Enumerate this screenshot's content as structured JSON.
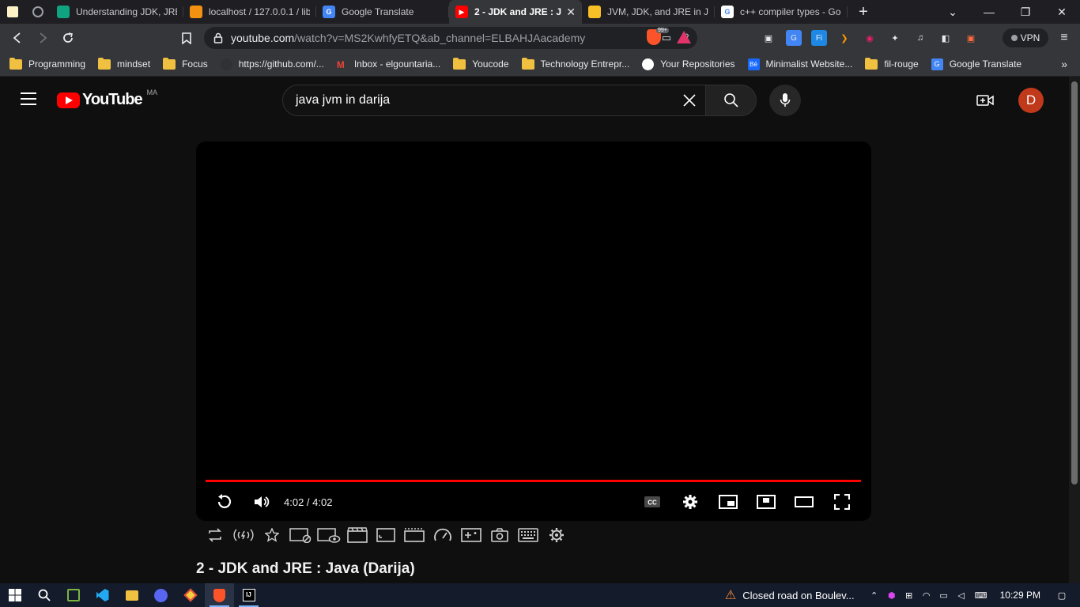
{
  "browser": {
    "tabs": [
      {
        "title": "Understanding JDK, JRE, J",
        "favicon_color": "#10a37f",
        "active": false
      },
      {
        "title": "localhost / 127.0.0.1 / libr",
        "favicon_color": "#f29111",
        "active": false
      },
      {
        "title": "Google Translate",
        "favicon_color": "#4285f4",
        "active": false
      },
      {
        "title": "2 - JDK and JRE : Java",
        "favicon_color": "#ff0000",
        "active": true
      },
      {
        "title": "JVM, JDK, and JRE in Java",
        "favicon_color": "#f6c026",
        "active": false
      },
      {
        "title": "c++ compiler types - Goo",
        "favicon_color": "#ffffff",
        "active": false
      }
    ],
    "address": {
      "domain": "youtube.com",
      "path": "/watch?v=MS2KwhfyETQ&ab_channel=ELBAHJAacademy"
    },
    "brave_badge": "99+",
    "vpn_label": "VPN",
    "bookmarks": [
      {
        "label": "Programming",
        "type": "folder"
      },
      {
        "label": "mindset",
        "type": "folder"
      },
      {
        "label": "Focus",
        "type": "folder"
      },
      {
        "label": "https://github.com/...",
        "type": "site",
        "icon": "github-icon"
      },
      {
        "label": "Inbox - elgountaria...",
        "type": "site",
        "icon": "gmail-icon"
      },
      {
        "label": "Youcode",
        "type": "folder"
      },
      {
        "label": "Technology Entrepr...",
        "type": "folder"
      },
      {
        "label": "Your Repositories",
        "type": "site",
        "icon": "github-icon"
      },
      {
        "label": "Minimalist Website...",
        "type": "site",
        "icon": "behance-icon"
      },
      {
        "label": "fil-rouge",
        "type": "folder"
      },
      {
        "label": "Google Translate",
        "type": "site",
        "icon": "translate-icon"
      }
    ]
  },
  "youtube": {
    "logo_text": "YouTube",
    "country_code": "MA",
    "search_query": "java jvm in darija",
    "avatar_letter": "D",
    "player": {
      "time": "4:02 / 4:02",
      "progress": 1.0
    },
    "video_title": "2 - JDK and JRE : Java (Darija)"
  },
  "taskbar": {
    "news": "Closed road on Boulev...",
    "time": "10:29 PM"
  },
  "colors": {
    "yt_red": "#ff0000",
    "avatar": "#c0391b",
    "folder": "#f0c040"
  }
}
